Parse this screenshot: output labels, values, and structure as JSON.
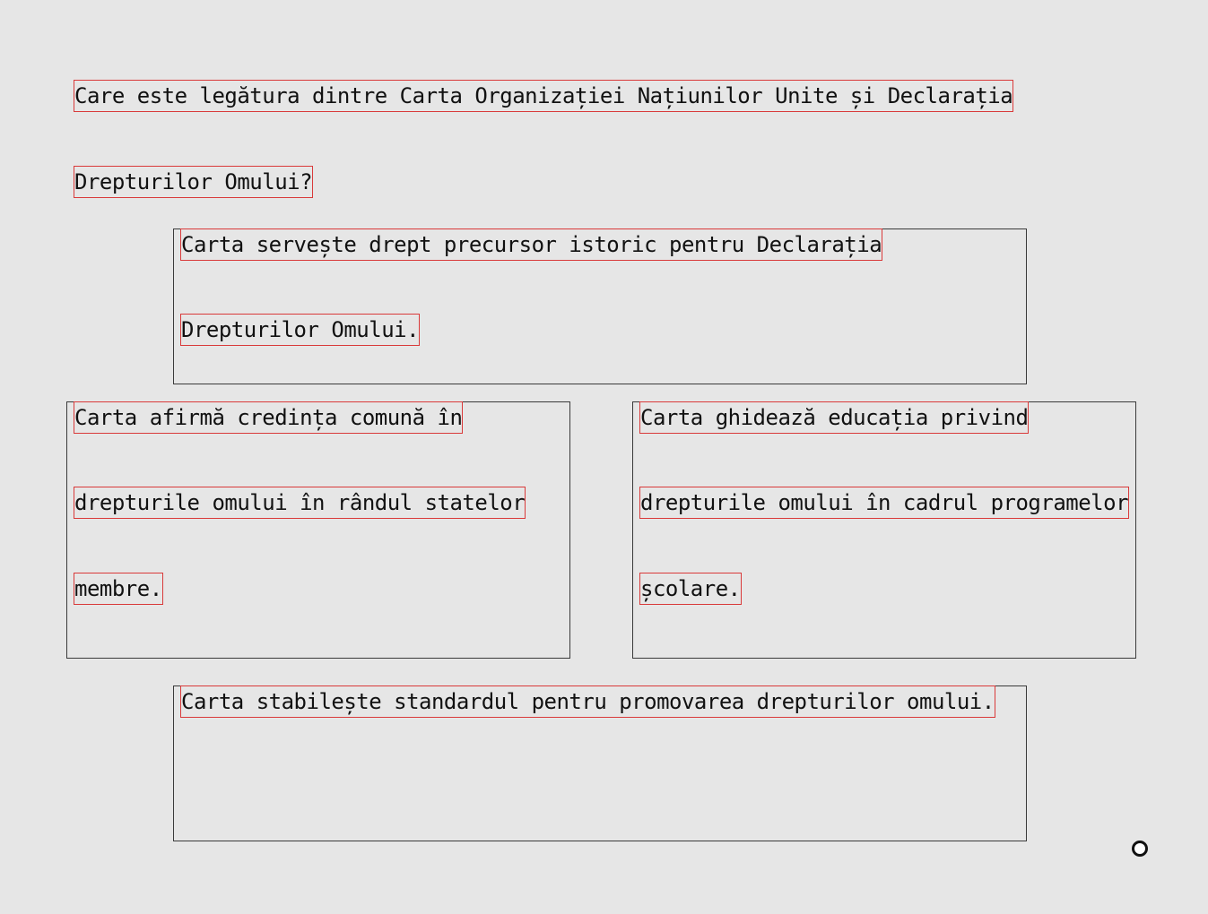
{
  "question": {
    "lines": [
      "Care este legătura dintre Carta Organizației Națiunilor Unite și Declarația",
      "Drepturilor Omului?"
    ]
  },
  "options": [
    {
      "lines": [
        "Carta servește drept precursor istoric pentru Declarația",
        "Drepturilor Omului."
      ]
    },
    {
      "lines": [
        "Carta afirmă credința comună în",
        "drepturile omului în rândul statelor",
        "membre."
      ]
    },
    {
      "lines": [
        "Carta ghidează educația privind",
        "drepturile omului în cadrul programelor",
        "școlare."
      ]
    },
    {
      "lines": [
        "Carta stabilește standardul pentru promovarea drepturilor omului."
      ]
    }
  ],
  "cursor": {
    "icon": "circle-cursor-icon"
  }
}
